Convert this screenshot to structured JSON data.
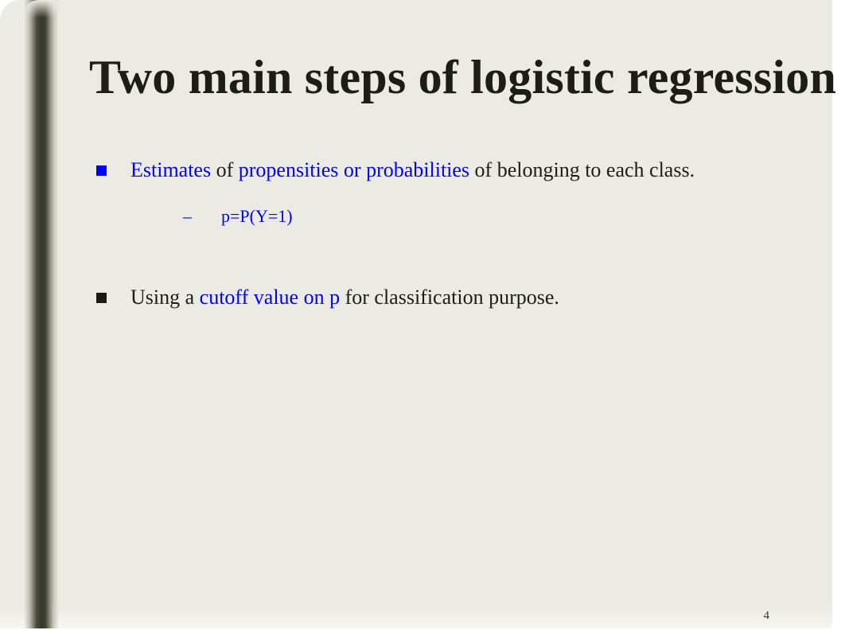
{
  "slide": {
    "title": "Two main steps of logistic regression",
    "page_number": "4",
    "colors": {
      "background": "#ECEBE3",
      "title_text": "#1C1E14",
      "accent_blue": "#0000FF",
      "left_bar_dark": "#33362A",
      "body_text": "#1C1E14"
    },
    "left_bar": {
      "name": "decorative-vertical-bar"
    },
    "bullets": [
      {
        "marker": "square-bullet-blue",
        "marker_color": "#0000FF",
        "segments": [
          {
            "text": "Estimates ",
            "color": "blue"
          },
          {
            "text": " of ",
            "color": "dark"
          },
          {
            "text": " propensities or probabilities ",
            "color": "blue"
          },
          {
            "text": " of belonging to each class.",
            "color": "dark"
          }
        ],
        "sub_bullets": [
          {
            "dash": "–",
            "text": "p=P(Y=1)",
            "color": "blue"
          }
        ]
      },
      {
        "marker": "square-bullet-dark",
        "marker_color": "#1A1C11",
        "segments": [
          {
            "text": "Using a ",
            "color": "dark"
          },
          {
            "text": "cutoff value on p",
            "color": "blue"
          },
          {
            "text": "  for classification purpose.",
            "color": "dark"
          }
        ],
        "sub_bullets": []
      }
    ]
  }
}
